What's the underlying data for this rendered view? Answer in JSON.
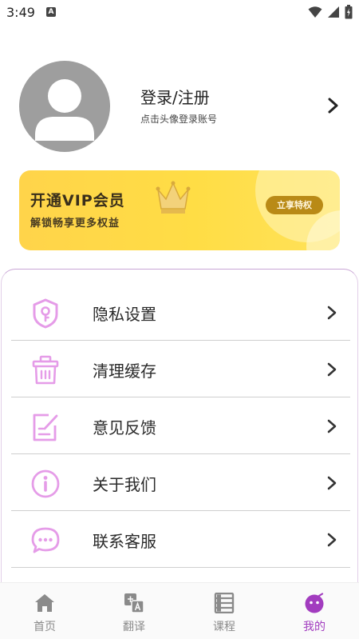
{
  "status_bar": {
    "time": "3:49",
    "notif_letter": "A"
  },
  "profile": {
    "title": "登录/注册",
    "subtitle": "点击头像登录账号"
  },
  "vip": {
    "title": "开通VIP会员",
    "subtitle": "解锁畅享更多权益",
    "button": "立享特权"
  },
  "menu": {
    "items": [
      {
        "label": "隐私设置",
        "icon": "shield-key-icon"
      },
      {
        "label": "清理缓存",
        "icon": "trash-bin-icon"
      },
      {
        "label": "意见反馈",
        "icon": "edit-note-icon"
      },
      {
        "label": "关于我们",
        "icon": "info-icon"
      },
      {
        "label": "联系客服",
        "icon": "chat-bubble-icon"
      }
    ]
  },
  "tabs": [
    {
      "label": "首页",
      "icon": "home-icon",
      "active": false
    },
    {
      "label": "翻译",
      "icon": "translate-icon",
      "active": false
    },
    {
      "label": "课程",
      "icon": "course-list-icon",
      "active": false
    },
    {
      "label": "我的",
      "icon": "profile-icon",
      "active": true
    }
  ],
  "colors": {
    "accent": "#a23cbf",
    "menu_icon": "#e59ce8",
    "vip_bg": "#ffd84a",
    "vip_button": "#b98a16"
  }
}
